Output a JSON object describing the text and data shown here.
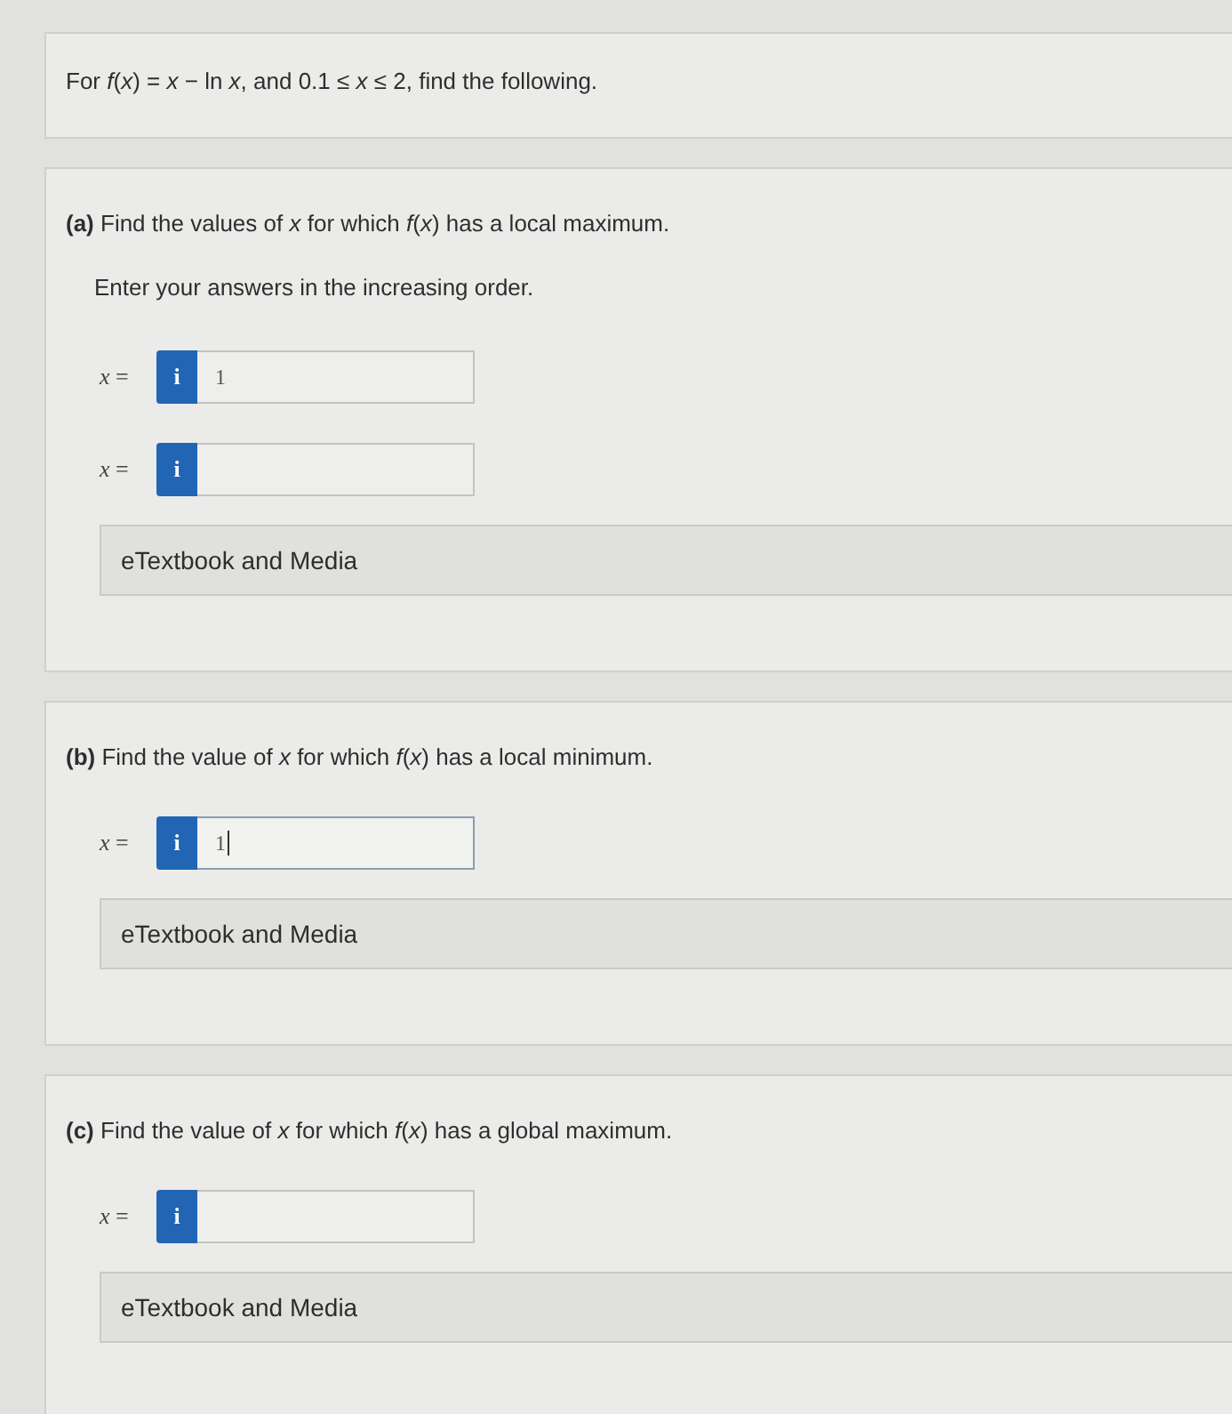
{
  "intro": {
    "text": "For *f*(*x*) = *x* − ln *x*, and 0.1 ≤ *x* ≤ 2, find the following."
  },
  "parts": [
    {
      "question": "**(a)** Find the values of *x* for which *f*(*x*) has a local maximum.",
      "instruction": "Enter your answers in the increasing order.",
      "answers": [
        {
          "label": "*x* =",
          "info_button": "i",
          "value": "1",
          "focused": false
        },
        {
          "label": "*x* =",
          "info_button": "i",
          "focused": false
        }
      ],
      "resource_button": "eTextbook and Media"
    },
    {
      "question": "**(b)** Find the value of *x* for which *f*(*x*) has a local minimum.",
      "answers": [
        {
          "label": "*x* =",
          "info_button": "i",
          "value": "1",
          "focused": true
        }
      ],
      "resource_button": "eTextbook and Media"
    },
    {
      "question": "**(c)** Find the value of *x* for which *f*(*x*) has a global maximum.",
      "answers": [
        {
          "label": "*x* =",
          "info_button": "i",
          "focused": false
        }
      ],
      "resource_button": "eTextbook and Media"
    }
  ]
}
